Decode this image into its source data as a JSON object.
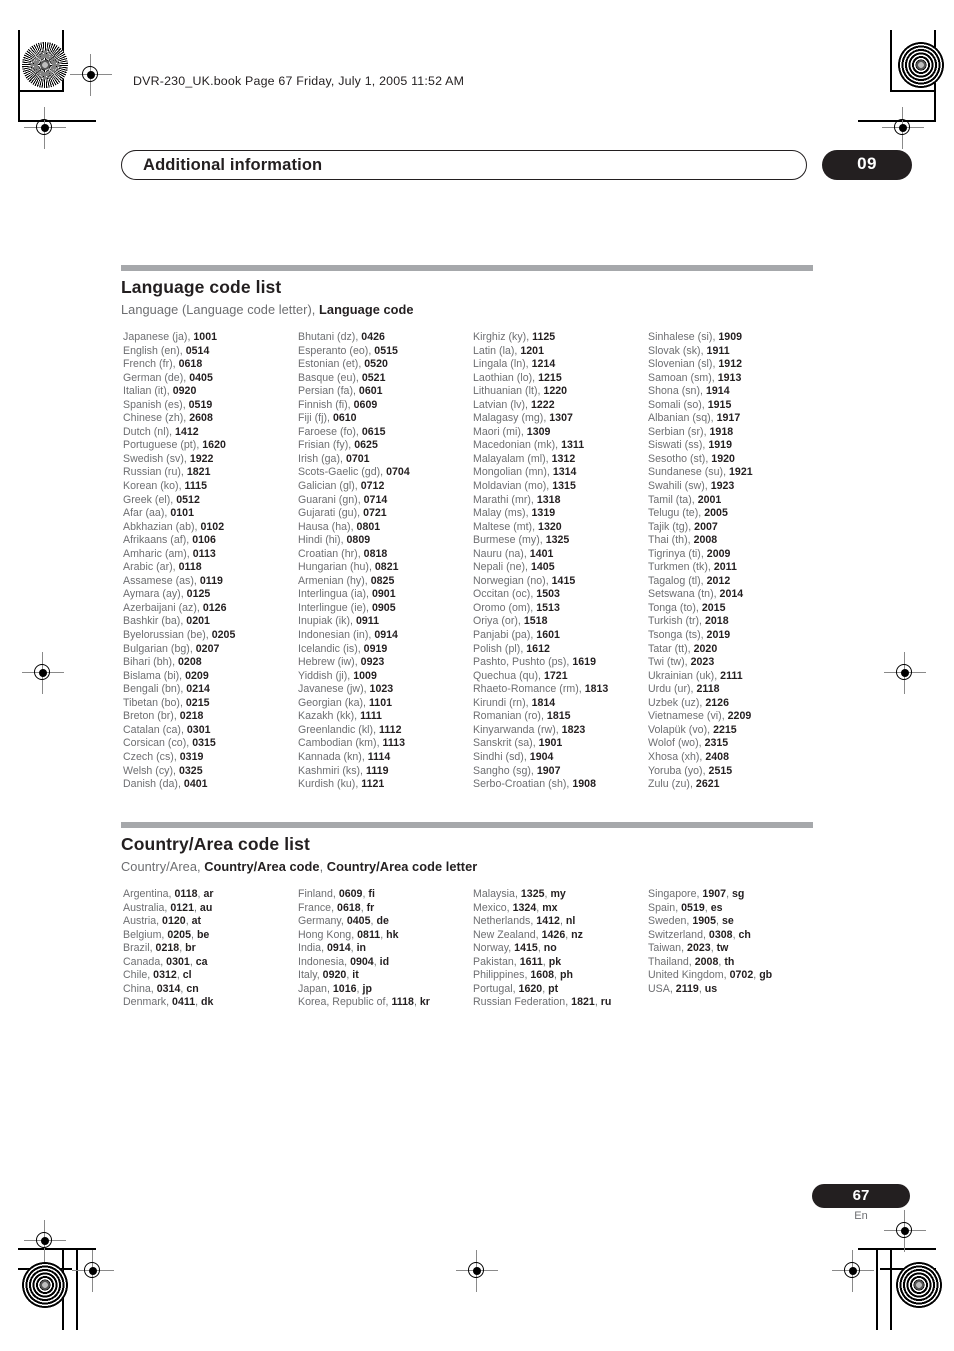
{
  "print_marks": {
    "book_line": "DVR-230_UK.book  Page 67  Friday, July 1, 2005  11:52 AM"
  },
  "running_head": {
    "title": "Additional information",
    "chapter": "09"
  },
  "folio": {
    "page_number": "67",
    "language": "En"
  },
  "sections": [
    {
      "title": "Language code list",
      "subtitle_plain": "Language (Language code letter), ",
      "subtitle_bold": "Language code"
    },
    {
      "title": "Country/Area code list",
      "subtitle_plain": "Country/Area, ",
      "subtitle_bold": "Country/Area code",
      "subtitle_plain2": ", ",
      "subtitle_bold2": "Country/Area code letter"
    }
  ],
  "language_codes": {
    "columns": [
      [
        {
          "name": "Japanese (ja), ",
          "code": "1001"
        },
        {
          "name": "English (en), ",
          "code": "0514"
        },
        {
          "name": "French (fr), ",
          "code": "0618"
        },
        {
          "name": "German (de), ",
          "code": "0405"
        },
        {
          "name": "Italian (it), ",
          "code": "0920"
        },
        {
          "name": "Spanish (es), ",
          "code": "0519"
        },
        {
          "name": "Chinese (zh), ",
          "code": "2608"
        },
        {
          "name": "Dutch (nl), ",
          "code": "1412"
        },
        {
          "name": "Portuguese (pt), ",
          "code": "1620"
        },
        {
          "name": "Swedish (sv), ",
          "code": "1922"
        },
        {
          "name": "Russian (ru), ",
          "code": "1821"
        },
        {
          "name": "Korean (ko), ",
          "code": "1115"
        },
        {
          "name": "Greek (el), ",
          "code": "0512"
        },
        {
          "name": "Afar (aa), ",
          "code": "0101"
        },
        {
          "name": "Abkhazian (ab), ",
          "code": "0102"
        },
        {
          "name": "Afrikaans (af), ",
          "code": "0106"
        },
        {
          "name": "Amharic (am), ",
          "code": "0113"
        },
        {
          "name": "Arabic (ar), ",
          "code": "0118"
        },
        {
          "name": "Assamese (as), ",
          "code": "0119"
        },
        {
          "name": "Aymara (ay), ",
          "code": "0125"
        },
        {
          "name": "Azerbaijani (az), ",
          "code": "0126"
        },
        {
          "name": "Bashkir (ba), ",
          "code": "0201"
        },
        {
          "name": "Byelorussian (be), ",
          "code": "0205"
        },
        {
          "name": "Bulgarian (bg), ",
          "code": "0207"
        },
        {
          "name": "Bihari (bh), ",
          "code": "0208"
        },
        {
          "name": "Bislama (bi), ",
          "code": "0209"
        },
        {
          "name": "Bengali (bn), ",
          "code": "0214"
        },
        {
          "name": "Tibetan (bo), ",
          "code": "0215"
        },
        {
          "name": "Breton (br), ",
          "code": "0218"
        },
        {
          "name": "Catalan (ca), ",
          "code": "0301"
        },
        {
          "name": "Corsican (co), ",
          "code": "0315"
        },
        {
          "name": "Czech (cs), ",
          "code": "0319"
        },
        {
          "name": "Welsh (cy), ",
          "code": "0325"
        },
        {
          "name": "Danish (da), ",
          "code": "0401"
        }
      ],
      [
        {
          "name": "Bhutani (dz), ",
          "code": "0426"
        },
        {
          "name": "Esperanto (eo), ",
          "code": "0515"
        },
        {
          "name": "Estonian (et), ",
          "code": "0520"
        },
        {
          "name": "Basque (eu), ",
          "code": "0521"
        },
        {
          "name": "Persian (fa), ",
          "code": "0601"
        },
        {
          "name": "Finnish (fi), ",
          "code": "0609"
        },
        {
          "name": "Fiji (fj), ",
          "code": "0610"
        },
        {
          "name": "Faroese (fo), ",
          "code": "0615"
        },
        {
          "name": "Frisian (fy), ",
          "code": "0625"
        },
        {
          "name": "Irish (ga), ",
          "code": "0701"
        },
        {
          "name": "Scots-Gaelic (gd), ",
          "code": "0704"
        },
        {
          "name": "Galician (gl), ",
          "code": "0712"
        },
        {
          "name": "Guarani (gn), ",
          "code": "0714"
        },
        {
          "name": "Gujarati (gu), ",
          "code": "0721"
        },
        {
          "name": "Hausa (ha), ",
          "code": "0801"
        },
        {
          "name": "Hindi (hi), ",
          "code": "0809"
        },
        {
          "name": "Croatian (hr), ",
          "code": "0818"
        },
        {
          "name": "Hungarian (hu), ",
          "code": "0821"
        },
        {
          "name": "Armenian (hy), ",
          "code": "0825"
        },
        {
          "name": "Interlingua (ia), ",
          "code": "0901"
        },
        {
          "name": "Interlingue (ie), ",
          "code": "0905"
        },
        {
          "name": "Inupiak (ik), ",
          "code": "0911"
        },
        {
          "name": "Indonesian (in), ",
          "code": "0914"
        },
        {
          "name": "Icelandic (is), ",
          "code": "0919"
        },
        {
          "name": "Hebrew (iw), ",
          "code": "0923"
        },
        {
          "name": "Yiddish (ji), ",
          "code": "1009"
        },
        {
          "name": "Javanese (jw), ",
          "code": "1023"
        },
        {
          "name": "Georgian (ka), ",
          "code": "1101"
        },
        {
          "name": "Kazakh (kk), ",
          "code": "1111"
        },
        {
          "name": "Greenlandic  (kl), ",
          "code": "1112"
        },
        {
          "name": "Cambodian (km), ",
          "code": "1113"
        },
        {
          "name": "Kannada (kn), ",
          "code": "1114"
        },
        {
          "name": "Kashmiri (ks), ",
          "code": "1119"
        },
        {
          "name": "Kurdish (ku), ",
          "code": "1121"
        }
      ],
      [
        {
          "name": "Kirghiz (ky), ",
          "code": "1125"
        },
        {
          "name": "Latin (la), ",
          "code": "1201"
        },
        {
          "name": "Lingala (ln), ",
          "code": "1214"
        },
        {
          "name": "Laothian (lo), ",
          "code": "1215"
        },
        {
          "name": "Lithuanian (lt), ",
          "code": "1220"
        },
        {
          "name": "Latvian (lv), ",
          "code": "1222"
        },
        {
          "name": "Malagasy (mg), ",
          "code": "1307"
        },
        {
          "name": "Maori (mi), ",
          "code": "1309"
        },
        {
          "name": "Macedonian (mk), ",
          "code": "1311"
        },
        {
          "name": "Malayalam  (ml), ",
          "code": "1312"
        },
        {
          "name": "Mongolian (mn), ",
          "code": "1314"
        },
        {
          "name": "Moldavian (mo), ",
          "code": "1315"
        },
        {
          "name": "Marathi (mr), ",
          "code": "1318"
        },
        {
          "name": "Malay  (ms), ",
          "code": "1319"
        },
        {
          "name": "Maltese (mt), ",
          "code": "1320"
        },
        {
          "name": "Burmese (my), ",
          "code": "1325"
        },
        {
          "name": "Nauru (na), ",
          "code": "1401"
        },
        {
          "name": "Nepali (ne), ",
          "code": "1405"
        },
        {
          "name": "Norwegian (no), ",
          "code": "1415"
        },
        {
          "name": "Occitan (oc), ",
          "code": "1503"
        },
        {
          "name": "Oromo (om), ",
          "code": "1513"
        },
        {
          "name": "Oriya (or), ",
          "code": "1518"
        },
        {
          "name": "Panjabi (pa), ",
          "code": "1601"
        },
        {
          "name": "Polish (pl), ",
          "code": "1612"
        },
        {
          "name": "Pashto, Pushto (ps), ",
          "code": "1619"
        },
        {
          "name": "Quechua (qu), ",
          "code": "1721"
        },
        {
          "name": "Rhaeto-Romance (rm), ",
          "code": "1813"
        },
        {
          "name": "Kirundi (rn), ",
          "code": "1814"
        },
        {
          "name": "Romanian (ro), ",
          "code": "1815"
        },
        {
          "name": "Kinyarwanda (rw), ",
          "code": "1823"
        },
        {
          "name": "Sanskrit (sa), ",
          "code": "1901"
        },
        {
          "name": "Sindhi (sd), ",
          "code": "1904"
        },
        {
          "name": "Sangho (sg), ",
          "code": "1907"
        },
        {
          "name": "Serbo-Croatian (sh), ",
          "code": "1908"
        }
      ],
      [
        {
          "name": "Sinhalese (si), ",
          "code": "1909"
        },
        {
          "name": "Slovak (sk), ",
          "code": "1911"
        },
        {
          "name": "Slovenian (sl), ",
          "code": "1912"
        },
        {
          "name": "Samoan (sm), ",
          "code": "1913"
        },
        {
          "name": "Shona (sn), ",
          "code": "1914"
        },
        {
          "name": "Somali (so), ",
          "code": "1915"
        },
        {
          "name": "Albanian (sq), ",
          "code": "1917"
        },
        {
          "name": "Serbian (sr), ",
          "code": "1918"
        },
        {
          "name": "Siswati (ss), ",
          "code": "1919"
        },
        {
          "name": "Sesotho (st), ",
          "code": "1920"
        },
        {
          "name": "Sundanese (su), ",
          "code": "1921"
        },
        {
          "name": "Swahili (sw), ",
          "code": "1923"
        },
        {
          "name": "Tamil (ta), ",
          "code": "2001"
        },
        {
          "name": "Telugu (te), ",
          "code": "2005"
        },
        {
          "name": "Tajik (tg), ",
          "code": "2007"
        },
        {
          "name": "Thai (th), ",
          "code": "2008"
        },
        {
          "name": "Tigrinya (ti), ",
          "code": "2009"
        },
        {
          "name": "Turkmen (tk), ",
          "code": "2011"
        },
        {
          "name": "Tagalog (tl), ",
          "code": "2012"
        },
        {
          "name": "Setswana (tn), ",
          "code": "2014"
        },
        {
          "name": "Tonga (to), ",
          "code": "2015"
        },
        {
          "name": "Turkish (tr), ",
          "code": "2018"
        },
        {
          "name": "Tsonga (ts), ",
          "code": "2019"
        },
        {
          "name": "Tatar (tt), ",
          "code": "2020"
        },
        {
          "name": "Twi (tw), ",
          "code": "2023"
        },
        {
          "name": "Ukrainian (uk), ",
          "code": "2111"
        },
        {
          "name": "Urdu (ur), ",
          "code": "2118"
        },
        {
          "name": "Uzbek (uz), ",
          "code": "2126"
        },
        {
          "name": "Vietnamese (vi), ",
          "code": "2209"
        },
        {
          "name": "Volapük (vo), ",
          "code": "2215"
        },
        {
          "name": "Wolof (wo), ",
          "code": "2315"
        },
        {
          "name": "Xhosa (xh), ",
          "code": "2408"
        },
        {
          "name": "Yoruba (yo), ",
          "code": "2515"
        },
        {
          "name": "Zulu (zu), ",
          "code": "2621"
        }
      ]
    ]
  },
  "country_codes": {
    "columns": [
      [
        {
          "name": "Argentina, ",
          "code": "0118",
          "sep": ", ",
          "letter": "ar"
        },
        {
          "name": "Australia, ",
          "code": "0121",
          "sep": ", ",
          "letter": "au"
        },
        {
          "name": "Austria, ",
          "code": "0120",
          "sep": ", ",
          "letter": "at"
        },
        {
          "name": "Belgium, ",
          "code": "0205",
          "sep": ", ",
          "letter": "be"
        },
        {
          "name": "Brazil, ",
          "code": "0218",
          "sep": ", ",
          "letter": "br"
        },
        {
          "name": "Canada, ",
          "code": "0301",
          "sep": ", ",
          "letter": "ca"
        },
        {
          "name": "Chile, ",
          "code": "0312",
          "sep": ", ",
          "letter": "cl"
        },
        {
          "name": "China, ",
          "code": "0314",
          "sep": ", ",
          "letter": "cn"
        },
        {
          "name": "Denmark, ",
          "code": "0411",
          "sep": ", ",
          "letter": "dk"
        }
      ],
      [
        {
          "name": "Finland, ",
          "code": "0609",
          "sep": ", ",
          "letter": "fi"
        },
        {
          "name": "France, ",
          "code": "0618",
          "sep": ", ",
          "letter": "fr"
        },
        {
          "name": "Germany, ",
          "code": "0405",
          "sep": ", ",
          "letter": "de"
        },
        {
          "name": "Hong Kong, ",
          "code": "0811",
          "sep": ", ",
          "letter": "hk"
        },
        {
          "name": "India, ",
          "code": "0914",
          "sep": ", ",
          "letter": "in"
        },
        {
          "name": "Indonesia, ",
          "code": "0904",
          "sep": ", ",
          "letter": "id"
        },
        {
          "name": "Italy, ",
          "code": "0920",
          "sep": ", ",
          "letter": "it"
        },
        {
          "name": "Japan, ",
          "code": "1016",
          "sep": ", ",
          "letter": "jp"
        },
        {
          "name": "Korea, Republic of, ",
          "code": "1118",
          "sep": ", ",
          "letter": "kr"
        }
      ],
      [
        {
          "name": "Malaysia, ",
          "code": "1325",
          "sep": ", ",
          "letter": "my"
        },
        {
          "name": "Mexico, ",
          "code": "1324",
          "sep": ", ",
          "letter": "mx"
        },
        {
          "name": "Netherlands, ",
          "code": "1412",
          "sep": ", ",
          "letter": "nl"
        },
        {
          "name": "New Zealand, ",
          "code": "1426",
          "sep": ", ",
          "letter": "nz"
        },
        {
          "name": "Norway, ",
          "code": "1415",
          "sep": ", ",
          "letter": "no"
        },
        {
          "name": "Pakistan, ",
          "code": "1611",
          "sep": ", ",
          "letter": "pk"
        },
        {
          "name": "Philippines, ",
          "code": "1608",
          "sep": ", ",
          "letter": "ph"
        },
        {
          "name": "Portugal, ",
          "code": "1620",
          "sep": ", ",
          "letter": "pt"
        },
        {
          "name": "Russian Federation, ",
          "code": "1821",
          "sep": ", ",
          "letter": "ru"
        }
      ],
      [
        {
          "name": "Singapore, ",
          "code": "1907",
          "sep": ", ",
          "letter": "sg"
        },
        {
          "name": "Spain, ",
          "code": "0519",
          "sep": ", ",
          "letter": "es"
        },
        {
          "name": "Sweden, ",
          "code": "1905",
          "sep": ", ",
          "letter": "se"
        },
        {
          "name": "Switzerland, ",
          "code": "0308",
          "sep": ", ",
          "letter": "ch"
        },
        {
          "name": "Taiwan, ",
          "code": "2023",
          "sep": ", ",
          "letter": "tw"
        },
        {
          "name": "Thailand, ",
          "code": "2008",
          "sep": ", ",
          "letter": "th"
        },
        {
          "name": "United Kingdom, ",
          "code": "0702",
          "sep": ", ",
          "letter": "gb"
        },
        {
          "name": "USA, ",
          "code": "2119",
          "sep": ", ",
          "letter": "us"
        }
      ]
    ]
  }
}
